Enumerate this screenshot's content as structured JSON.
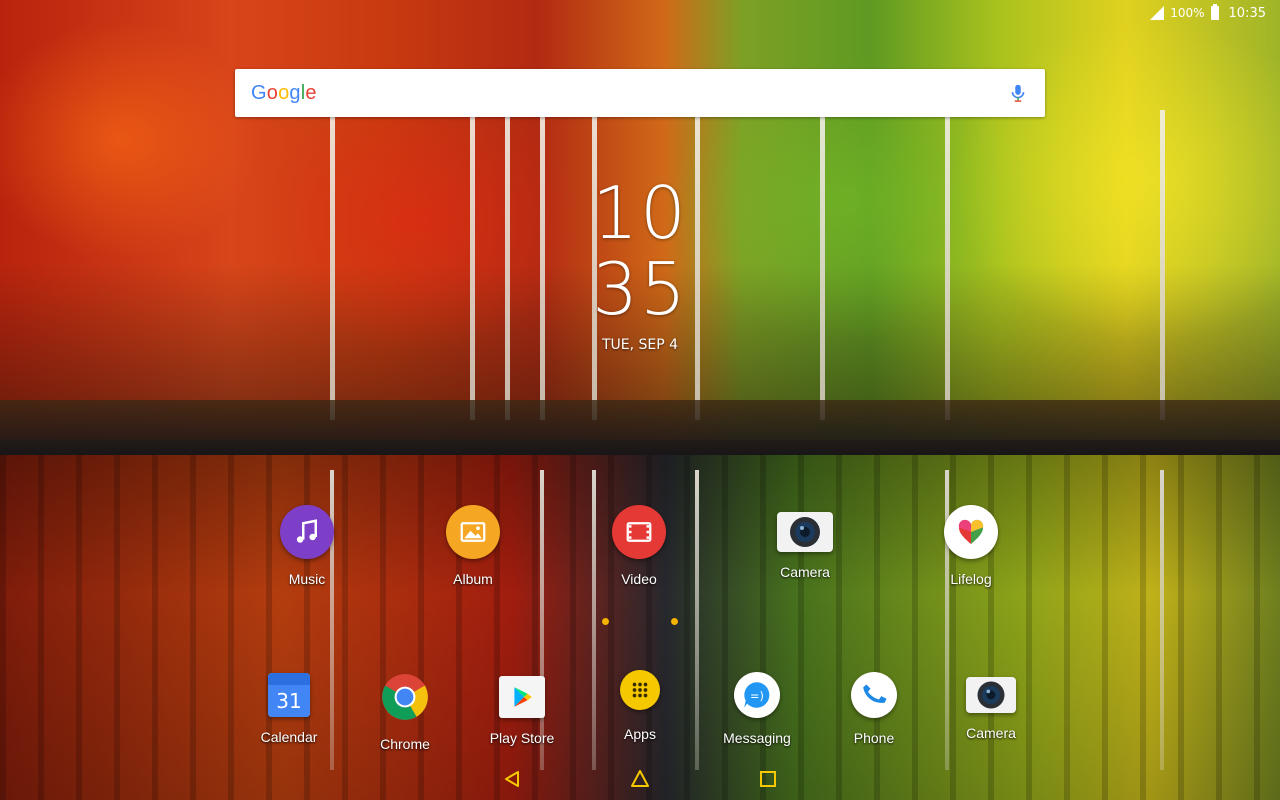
{
  "status_bar": {
    "battery_percent": "100%",
    "time": "10:35",
    "icons": [
      "signal-icon",
      "battery-icon"
    ]
  },
  "search": {
    "logo_text": [
      "G",
      "o",
      "o",
      "g",
      "l",
      "e"
    ],
    "mic_icon": "mic-icon"
  },
  "clock": {
    "hours": "10",
    "minutes": "35",
    "date": "TUE, SEP 4"
  },
  "home_apps": [
    {
      "label": "Music",
      "icon": "music-icon",
      "color": "#7e3fc8"
    },
    {
      "label": "Album",
      "icon": "album-icon",
      "color": "#f5a623"
    },
    {
      "label": "Video",
      "icon": "video-icon",
      "color": "#e53935"
    },
    {
      "label": "Camera",
      "icon": "camera-icon",
      "color": "#f5f5f5"
    },
    {
      "label": "Lifelog",
      "icon": "lifelog-icon",
      "color": "#ffffff"
    }
  ],
  "dock_apps": [
    {
      "label": "Calendar",
      "icon": "calendar-icon",
      "badge": "31",
      "color": "#4285f4"
    },
    {
      "label": "Chrome",
      "icon": "chrome-icon"
    },
    {
      "label": "Play Store",
      "icon": "play-store-icon"
    },
    {
      "label": "Apps",
      "icon": "apps-grid-icon",
      "color": "#f6c800"
    },
    {
      "label": "Messaging",
      "icon": "messaging-icon",
      "color": "#2196f3"
    },
    {
      "label": "Phone",
      "icon": "phone-icon",
      "color": "#2196f3"
    },
    {
      "label": "Camera",
      "icon": "camera-icon"
    }
  ],
  "nav_bar": {
    "buttons": [
      "back-icon",
      "home-icon",
      "recents-icon"
    ],
    "accent": "#f6c800"
  }
}
